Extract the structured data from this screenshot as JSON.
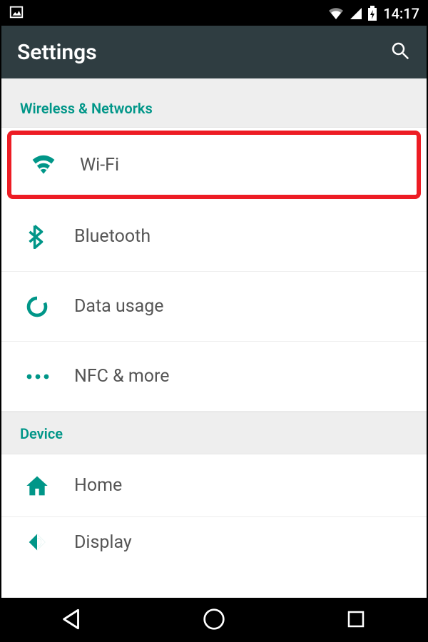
{
  "status": {
    "time": "14:17"
  },
  "header": {
    "title": "Settings"
  },
  "sections": {
    "wireless": {
      "title": "Wireless & Networks",
      "items": {
        "wifi": "Wi-Fi",
        "bluetooth": "Bluetooth",
        "data": "Data usage",
        "nfc": "NFC & more"
      }
    },
    "device": {
      "title": "Device",
      "items": {
        "home": "Home",
        "display": "Display"
      }
    }
  },
  "colors": {
    "accent": "#009688",
    "highlight": "#ed1c24",
    "header_bg": "#2f3d41"
  }
}
